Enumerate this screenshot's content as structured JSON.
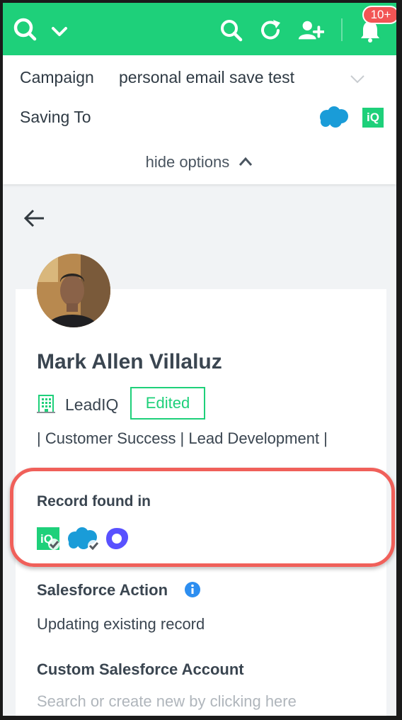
{
  "topbar": {
    "notification_badge": "10+",
    "accent_color": "#1ed07a",
    "icons": [
      "leadiq-logo-icon",
      "chevron-down-icon",
      "search-icon",
      "refresh-icon",
      "add-user-icon",
      "bell-icon"
    ]
  },
  "options": {
    "campaign_label": "Campaign",
    "campaign_value": "personal email save test",
    "saving_to_label": "Saving To",
    "iq_label": "iQ",
    "hide_options_label": "hide options"
  },
  "profile": {
    "name": "Mark Allen Villaluz",
    "company": "LeadIQ",
    "edited_label": "Edited",
    "title_line": "| Customer Success | Lead Development |"
  },
  "record": {
    "label": "Record found in",
    "iq_label": "iQ",
    "sources": [
      "leadiq",
      "salesforce",
      "outreach"
    ]
  },
  "salesforce": {
    "action_label": "Salesforce Action",
    "action_value": "Updating existing record",
    "custom_account_label": "Custom Salesforce Account",
    "account_placeholder": "Search or create new by clicking here"
  },
  "colors": {
    "green": "#1ed07a",
    "highlight_red": "#f0605a",
    "salesforce_blue": "#1a9cd8",
    "outreach_purple": "#5951ff",
    "badge_red": "#f25555"
  }
}
